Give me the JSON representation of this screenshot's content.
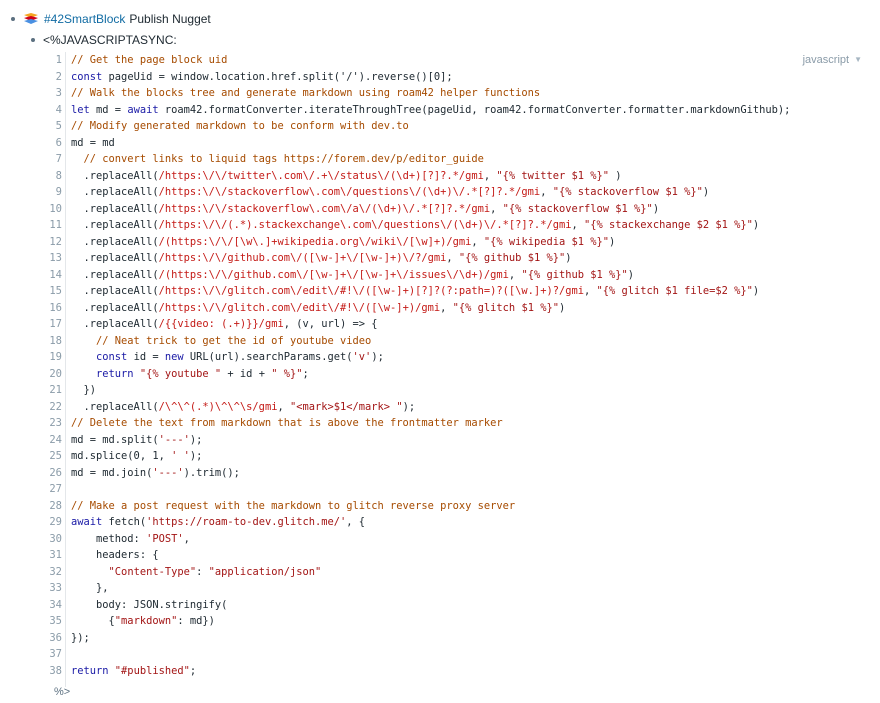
{
  "block1": {
    "tag": "#42SmartBlock",
    "title": "Publish Nugget"
  },
  "block2": {
    "text": "<%JAVASCRIPTASYNC:"
  },
  "code": {
    "language": "javascript",
    "lines": [
      {
        "n": "1",
        "segs": [
          {
            "t": "// Get the page block uid",
            "c": "c"
          }
        ]
      },
      {
        "n": "2",
        "segs": [
          {
            "t": "const ",
            "c": "k"
          },
          {
            "t": "pageUid = window.location.href.split('/').reverse()[0];",
            "c": ""
          }
        ]
      },
      {
        "n": "3",
        "segs": [
          {
            "t": "// Walk the blocks tree and generate markdown using roam42 helper functions",
            "c": "c"
          }
        ]
      },
      {
        "n": "4",
        "segs": [
          {
            "t": "let ",
            "c": "k"
          },
          {
            "t": "md = ",
            "c": ""
          },
          {
            "t": "await ",
            "c": "k"
          },
          {
            "t": "roam42.formatConverter.iterateThroughTree(pageUid, roam42.formatConverter.formatter.markdownGithub);",
            "c": ""
          }
        ]
      },
      {
        "n": "5",
        "segs": [
          {
            "t": "// Modify generated markdown to be conform with dev.to",
            "c": "c"
          }
        ]
      },
      {
        "n": "6",
        "segs": [
          {
            "t": "md = md",
            "c": ""
          }
        ]
      },
      {
        "n": "7",
        "segs": [
          {
            "t": "  // convert links to liquid tags https://forem.dev/p/editor_guide",
            "c": "c"
          }
        ]
      },
      {
        "n": "8",
        "segs": [
          {
            "t": "  .replaceAll(",
            "c": ""
          },
          {
            "t": "/https:\\/\\/twitter\\.com\\/.+\\/status\\/(\\d+)[?]?.*/gmi",
            "c": "r"
          },
          {
            "t": ", ",
            "c": ""
          },
          {
            "t": "\"{% twitter $1 %}\"",
            "c": "s"
          },
          {
            "t": " )",
            "c": ""
          }
        ]
      },
      {
        "n": "9",
        "segs": [
          {
            "t": "  .replaceAll(",
            "c": ""
          },
          {
            "t": "/https:\\/\\/stackoverflow\\.com\\/questions\\/(\\d+)\\/.*[?]?.*/gmi",
            "c": "r"
          },
          {
            "t": ", ",
            "c": ""
          },
          {
            "t": "\"{% stackoverflow $1 %}\"",
            "c": "s"
          },
          {
            "t": ")",
            "c": ""
          }
        ]
      },
      {
        "n": "10",
        "segs": [
          {
            "t": "  .replaceAll(",
            "c": ""
          },
          {
            "t": "/https:\\/\\/stackoverflow\\.com\\/a\\/(\\d+)\\/.*[?]?.*/gmi",
            "c": "r"
          },
          {
            "t": ", ",
            "c": ""
          },
          {
            "t": "\"{% stackoverflow $1 %}\"",
            "c": "s"
          },
          {
            "t": ")",
            "c": ""
          }
        ]
      },
      {
        "n": "11",
        "segs": [
          {
            "t": "  .replaceAll(",
            "c": ""
          },
          {
            "t": "/https:\\/\\/(.*).stackexchange\\.com\\/questions\\/(\\d+)\\/.*[?]?.*/gmi",
            "c": "r"
          },
          {
            "t": ", ",
            "c": ""
          },
          {
            "t": "\"{% stackexchange $2 $1 %}\"",
            "c": "s"
          },
          {
            "t": ")",
            "c": ""
          }
        ]
      },
      {
        "n": "12",
        "segs": [
          {
            "t": "  .replaceAll(",
            "c": ""
          },
          {
            "t": "/(https:\\/\\/[\\w\\.]+wikipedia.org\\/wiki\\/[\\w]+)/gmi",
            "c": "r"
          },
          {
            "t": ", ",
            "c": ""
          },
          {
            "t": "\"{% wikipedia $1 %}\"",
            "c": "s"
          },
          {
            "t": ")",
            "c": ""
          }
        ]
      },
      {
        "n": "13",
        "segs": [
          {
            "t": "  .replaceAll(",
            "c": ""
          },
          {
            "t": "/https:\\/\\/github.com\\/([\\w-]+\\/[\\w-]+)\\/?/gmi",
            "c": "r"
          },
          {
            "t": ", ",
            "c": ""
          },
          {
            "t": "\"{% github $1 %}\"",
            "c": "s"
          },
          {
            "t": ")",
            "c": ""
          }
        ]
      },
      {
        "n": "14",
        "segs": [
          {
            "t": "  .replaceAll(",
            "c": ""
          },
          {
            "t": "/(https:\\/\\/github.com\\/[\\w-]+\\/[\\w-]+\\/issues\\/\\d+)/gmi",
            "c": "r"
          },
          {
            "t": ", ",
            "c": ""
          },
          {
            "t": "\"{% github $1 %}\"",
            "c": "s"
          },
          {
            "t": ")",
            "c": ""
          }
        ]
      },
      {
        "n": "15",
        "segs": [
          {
            "t": "  .replaceAll(",
            "c": ""
          },
          {
            "t": "/https:\\/\\/glitch.com\\/edit\\/#!\\/([\\w-]+)[?]?(?:path=)?([\\w.]+)?/gmi",
            "c": "r"
          },
          {
            "t": ", ",
            "c": ""
          },
          {
            "t": "\"{% glitch $1 file=$2 %}\"",
            "c": "s"
          },
          {
            "t": ")",
            "c": ""
          }
        ]
      },
      {
        "n": "16",
        "segs": [
          {
            "t": "  .replaceAll(",
            "c": ""
          },
          {
            "t": "/https:\\/\\/glitch.com\\/edit\\/#!\\/([\\w-]+)/gmi",
            "c": "r"
          },
          {
            "t": ", ",
            "c": ""
          },
          {
            "t": "\"{% glitch $1 %}\"",
            "c": "s"
          },
          {
            "t": ")",
            "c": ""
          }
        ]
      },
      {
        "n": "17",
        "segs": [
          {
            "t": "  .replaceAll(",
            "c": ""
          },
          {
            "t": "/{{video: (.+)}}/gmi",
            "c": "r"
          },
          {
            "t": ", (v, url) => {",
            "c": ""
          }
        ]
      },
      {
        "n": "18",
        "segs": [
          {
            "t": "    // Neat trick to get the id of youtube video",
            "c": "c"
          }
        ]
      },
      {
        "n": "19",
        "segs": [
          {
            "t": "    ",
            "c": ""
          },
          {
            "t": "const ",
            "c": "k"
          },
          {
            "t": "id = ",
            "c": ""
          },
          {
            "t": "new ",
            "c": "k"
          },
          {
            "t": "URL(url).searchParams.get(",
            "c": ""
          },
          {
            "t": "'v'",
            "c": "s"
          },
          {
            "t": ");",
            "c": ""
          }
        ]
      },
      {
        "n": "20",
        "segs": [
          {
            "t": "    ",
            "c": ""
          },
          {
            "t": "return ",
            "c": "k"
          },
          {
            "t": "\"{% youtube \"",
            "c": "s"
          },
          {
            "t": " + id + ",
            "c": ""
          },
          {
            "t": "\" %}\"",
            "c": "s"
          },
          {
            "t": ";",
            "c": ""
          }
        ]
      },
      {
        "n": "21",
        "segs": [
          {
            "t": "  })",
            "c": ""
          }
        ]
      },
      {
        "n": "22",
        "segs": [
          {
            "t": "  .replaceAll(",
            "c": ""
          },
          {
            "t": "/\\^\\^(.*)\\^\\^\\s/gmi",
            "c": "r"
          },
          {
            "t": ", ",
            "c": ""
          },
          {
            "t": "\"<mark>$1</mark> \"",
            "c": "s"
          },
          {
            "t": ");",
            "c": ""
          }
        ]
      },
      {
        "n": "23",
        "segs": [
          {
            "t": "// Delete the text from markdown that is above the frontmatter marker",
            "c": "c"
          }
        ]
      },
      {
        "n": "24",
        "segs": [
          {
            "t": "md = md.split(",
            "c": ""
          },
          {
            "t": "'---'",
            "c": "s"
          },
          {
            "t": ");",
            "c": ""
          }
        ]
      },
      {
        "n": "25",
        "segs": [
          {
            "t": "md.splice(0, 1, ",
            "c": ""
          },
          {
            "t": "' '",
            "c": "s"
          },
          {
            "t": ");",
            "c": ""
          }
        ]
      },
      {
        "n": "26",
        "segs": [
          {
            "t": "md = md.join(",
            "c": ""
          },
          {
            "t": "'---'",
            "c": "s"
          },
          {
            "t": ").trim();",
            "c": ""
          }
        ]
      },
      {
        "n": "27",
        "segs": [
          {
            "t": "",
            "c": ""
          }
        ]
      },
      {
        "n": "28",
        "segs": [
          {
            "t": "// Make a post request with the markdown to glitch reverse proxy server",
            "c": "c"
          }
        ]
      },
      {
        "n": "29",
        "segs": [
          {
            "t": "await ",
            "c": "k"
          },
          {
            "t": "fetch(",
            "c": ""
          },
          {
            "t": "'https://roam-to-dev.glitch.me/'",
            "c": "s"
          },
          {
            "t": ", {",
            "c": ""
          }
        ]
      },
      {
        "n": "30",
        "segs": [
          {
            "t": "    method: ",
            "c": ""
          },
          {
            "t": "'POST'",
            "c": "s"
          },
          {
            "t": ",",
            "c": ""
          }
        ]
      },
      {
        "n": "31",
        "segs": [
          {
            "t": "    headers: {",
            "c": ""
          }
        ]
      },
      {
        "n": "32",
        "segs": [
          {
            "t": "      ",
            "c": ""
          },
          {
            "t": "\"Content-Type\"",
            "c": "s"
          },
          {
            "t": ": ",
            "c": ""
          },
          {
            "t": "\"application/json\"",
            "c": "s"
          }
        ]
      },
      {
        "n": "33",
        "segs": [
          {
            "t": "    },",
            "c": ""
          }
        ]
      },
      {
        "n": "34",
        "segs": [
          {
            "t": "    body: JSON.stringify(",
            "c": ""
          }
        ]
      },
      {
        "n": "35",
        "segs": [
          {
            "t": "      {",
            "c": ""
          },
          {
            "t": "\"markdown\"",
            "c": "s"
          },
          {
            "t": ": md})",
            "c": ""
          }
        ]
      },
      {
        "n": "36",
        "segs": [
          {
            "t": "});",
            "c": ""
          }
        ]
      },
      {
        "n": "37",
        "segs": [
          {
            "t": "",
            "c": ""
          }
        ]
      },
      {
        "n": "38",
        "segs": [
          {
            "t": "return ",
            "c": "k"
          },
          {
            "t": "\"#published\"",
            "c": "s"
          },
          {
            "t": ";",
            "c": ""
          }
        ]
      }
    ]
  },
  "closing": "%>"
}
